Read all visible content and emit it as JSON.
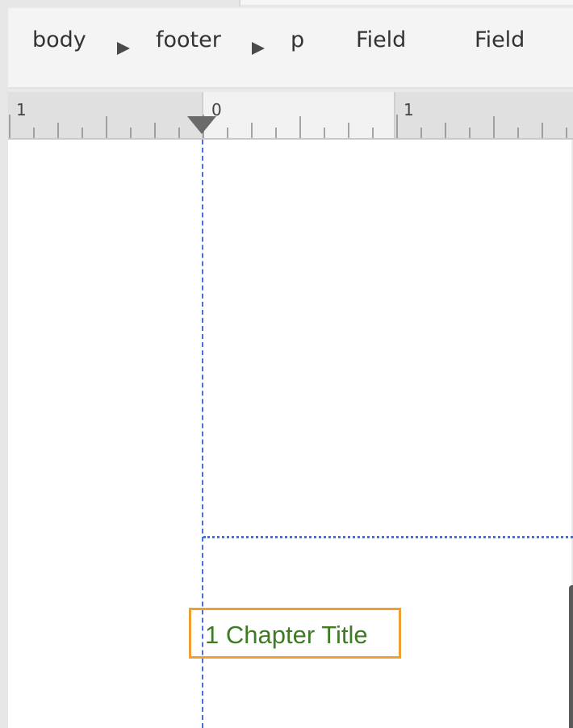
{
  "breadcrumb": {
    "items": [
      {
        "label": "body"
      },
      {
        "label": "footer"
      },
      {
        "label": "p"
      },
      {
        "label": "Field"
      },
      {
        "label": "Field"
      }
    ]
  },
  "ruler": {
    "labels": [
      "1",
      "0",
      "1"
    ]
  },
  "document": {
    "field_text": "1 Chapter Title"
  },
  "colors": {
    "field_border": "#f0a033",
    "field_text": "#3f7a25",
    "guide": "#4a6fd6"
  }
}
